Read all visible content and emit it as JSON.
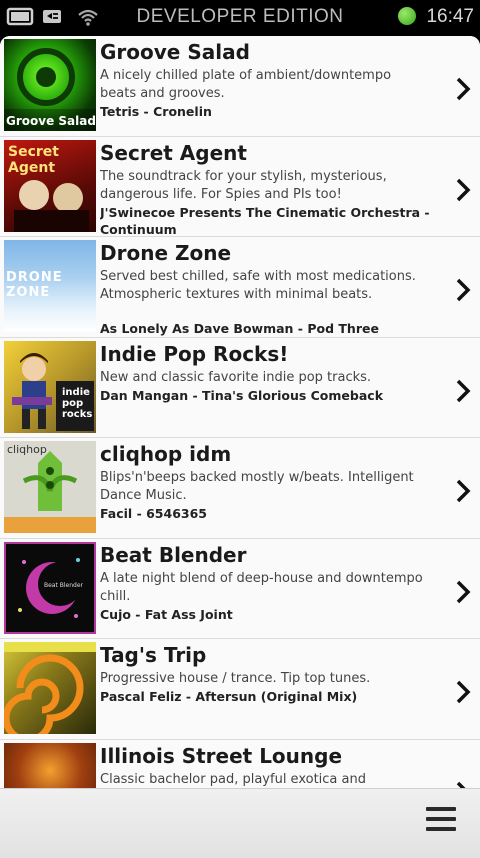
{
  "status_bar": {
    "title": "DEVELOPER EDITION",
    "time": "16:47",
    "battery_color": "#52c41a"
  },
  "stations": [
    {
      "title": "Groove Salad",
      "description": "A nicely chilled plate of ambient/downtempo beats and grooves.",
      "now_playing": "Tetris - Cronelin",
      "thumb_label": "Groove Salad",
      "thumb_icon": "groove-salad-art"
    },
    {
      "title": "Secret Agent",
      "description": "The soundtrack for your stylish, mysterious, dangerous life. For Spies and PIs too!",
      "now_playing": "J'Swinecoe Presents The Cinematic Orchestra - Continuum",
      "thumb_label": "Secret Agent",
      "thumb_icon": "secret-agent-art"
    },
    {
      "title": "Drone Zone",
      "description": "Served best chilled, safe with most medications. Atmospheric textures with minimal beats.",
      "now_playing": "As Lonely As Dave Bowman - Pod Three",
      "thumb_label": "DRONE ZONE",
      "thumb_icon": "drone-zone-art"
    },
    {
      "title": "Indie Pop Rocks!",
      "description": "New and classic favorite indie pop tracks.",
      "now_playing": "Dan Mangan - Tina's Glorious Comeback",
      "thumb_label": "indie pop rocks",
      "thumb_icon": "indie-pop-art"
    },
    {
      "title": "cliqhop idm",
      "description": "Blips'n'beeps backed mostly w/beats. Intelligent Dance Music.",
      "now_playing": "Facil - 6546365",
      "thumb_label": "cliqhop",
      "thumb_icon": "cliqhop-art"
    },
    {
      "title": "Beat Blender",
      "description": "A late night blend of deep-house and downtempo chill.",
      "now_playing": "Cujo - Fat Ass Joint",
      "thumb_label": "Beat Blender",
      "thumb_icon": "beat-blender-art"
    },
    {
      "title": "Tag's Trip",
      "description": "Progressive house / trance. Tip top tunes.",
      "now_playing": "Pascal Feliz - Aftersun (Original Mix)",
      "thumb_label": "",
      "thumb_icon": "tags-trip-art"
    },
    {
      "title": "Illinois Street Lounge",
      "description": "Classic bachelor pad, playful exotica and",
      "now_playing": "",
      "thumb_label": "",
      "thumb_icon": "illinois-lounge-art"
    }
  ],
  "bottom_bar": {
    "menu_icon": "hamburger-menu-icon"
  }
}
